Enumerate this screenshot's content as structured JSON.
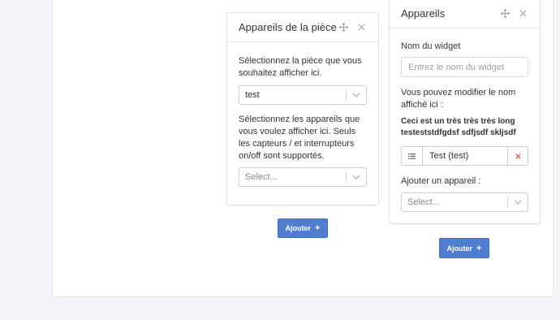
{
  "card1": {
    "title": "Appareils de la pièce",
    "room_prompt": "Sélectionnez la pièce que vous souhaitez afficher ici.",
    "room_value": "test",
    "devices_prompt": "Sélectionnez les appareils que vous voulez afficher ici. Seuls les capteurs / et interrupteurs on/off sont supportés.",
    "devices_placeholder": "Select...",
    "add_button": "Ajouter"
  },
  "card2": {
    "title": "Appareils",
    "widget_name_label": "Nom du widget",
    "widget_name_placeholder": "Entrez le nom du widget",
    "modify_label": "Vous pouvez modifier le nom affiché ici :",
    "long_name": "Ceci est un très très très long testeststdfgdsf sdfjsdf skljsdf",
    "device_item": "Test (test)",
    "add_device_label": "Ajouter un appareil :",
    "add_device_placeholder": "Select...",
    "add_button": "Ajouter"
  },
  "icons": {
    "move": "move-icon",
    "close": "close-icon",
    "chevron": "chevron-down-icon",
    "list": "list-icon",
    "delete": "delete-x-icon",
    "plus": "plus-icon"
  },
  "colors": {
    "primary": "#4f7ed0",
    "danger": "#d0443c",
    "background": "#f4f5f8"
  }
}
